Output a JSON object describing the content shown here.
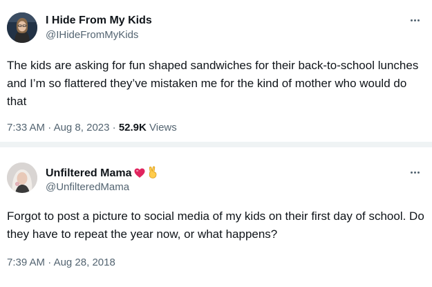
{
  "tweets": [
    {
      "display_name": "I Hide From My Kids",
      "handle": "@IHideFromMyKids",
      "text": "The kids are asking for fun shaped sandwiches for their back-to-school lunches and I’m so flattered they’ve mistaken me for the kind of mother who would do that",
      "time": "7:33 AM",
      "date": "Aug 8, 2023",
      "views_count": "52.9K",
      "views_label": "Views"
    },
    {
      "display_name": "Unfiltered Mama",
      "name_emojis": [
        "heart-emoji",
        "victory-hand-emoji"
      ],
      "handle": "@UnfilteredMama",
      "text": "Forgot to post a picture to social media of my kids on their first day of school. Do they have to repeat the year now, or what happens?",
      "time": "7:39 AM",
      "date": "Aug 28, 2018"
    }
  ],
  "separator": " · ",
  "colors": {
    "text": "#0f1419",
    "secondary": "#536471",
    "divider": "#eff3f4",
    "heart": "#e0245e"
  },
  "icons": {
    "more": "more-options-icon"
  }
}
